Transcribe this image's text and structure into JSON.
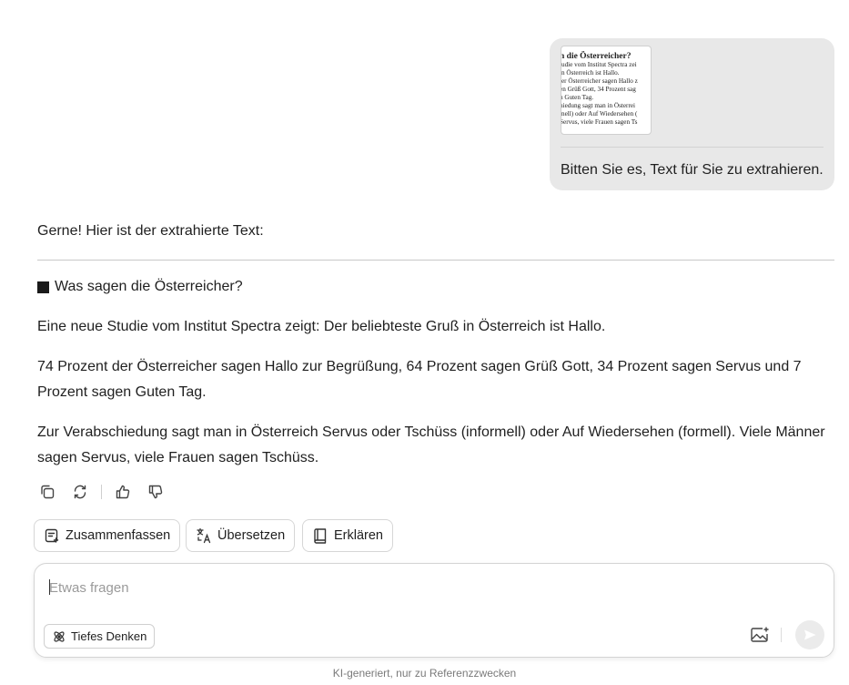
{
  "user_message": {
    "attachment": {
      "title": "n die Österreicher?",
      "lines": [
        "tudie vom Institut Spectra zei",
        "in Österreich ist Hallo.",
        "ler Österreicher sagen Hallo z",
        "en Grüß Gott, 34 Prozent sag",
        "n Guten Tag.",
        "hiedung sagt man in Österrei",
        "mell) oder Auf Wiedersehen (",
        "Servus, viele Frauen sagen Ts"
      ]
    },
    "text": "Bitten Sie es, Text für Sie zu extrahieren."
  },
  "response": {
    "intro": "Gerne! Hier ist der extrahierte Text:",
    "heading": "Was sagen die Österreicher?",
    "paragraphs": [
      "Eine neue Studie vom Institut Spectra zeigt: Der beliebteste Gruß in Österreich ist Hallo.",
      "74 Prozent der Österreicher sagen Hallo zur Begrüßung, 64 Prozent sagen Grüß Gott, 34 Prozent sagen Servus und 7 Prozent sagen Guten Tag.",
      "Zur Verabschiedung sagt man in Österreich Servus oder Tschüss (informell) oder Auf Wiedersehen (formell). Viele Männer sagen Servus, viele Frauen sagen Tschüss."
    ]
  },
  "actions": [
    "copy-icon",
    "regenerate-icon",
    "thumbs-up-icon",
    "thumbs-down-icon"
  ],
  "chips": {
    "summarize": "Zusammenfassen",
    "translate": "Übersetzen",
    "explain": "Erklären"
  },
  "input": {
    "placeholder": "Etwas fragen",
    "deep_think_label": "Tiefes Denken"
  },
  "footer": "KI-generiert, nur zu Referenzzwecken",
  "colors": {
    "bubble_bg": "#e8e8e8",
    "text": "#1f1f1f",
    "muted": "#7a7a7a",
    "send_bg": "#ebebeb"
  }
}
